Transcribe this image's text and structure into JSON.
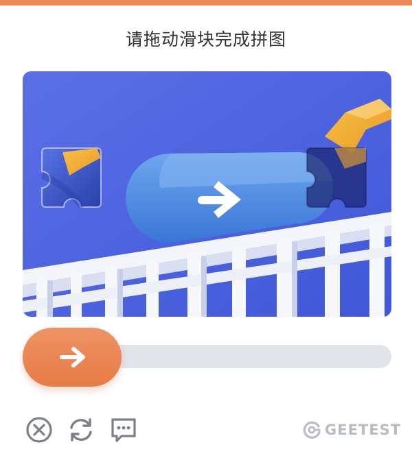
{
  "captcha": {
    "title": "请拖动滑块完成拼图",
    "accent_color": "#ea8753",
    "slider": {
      "handle_icon": "arrow-right-icon",
      "position": 0
    },
    "footer": {
      "close_icon": "close-circle-icon",
      "refresh_icon": "refresh-icon",
      "feedback_icon": "feedback-chat-icon",
      "brand": "GEETEST"
    }
  }
}
